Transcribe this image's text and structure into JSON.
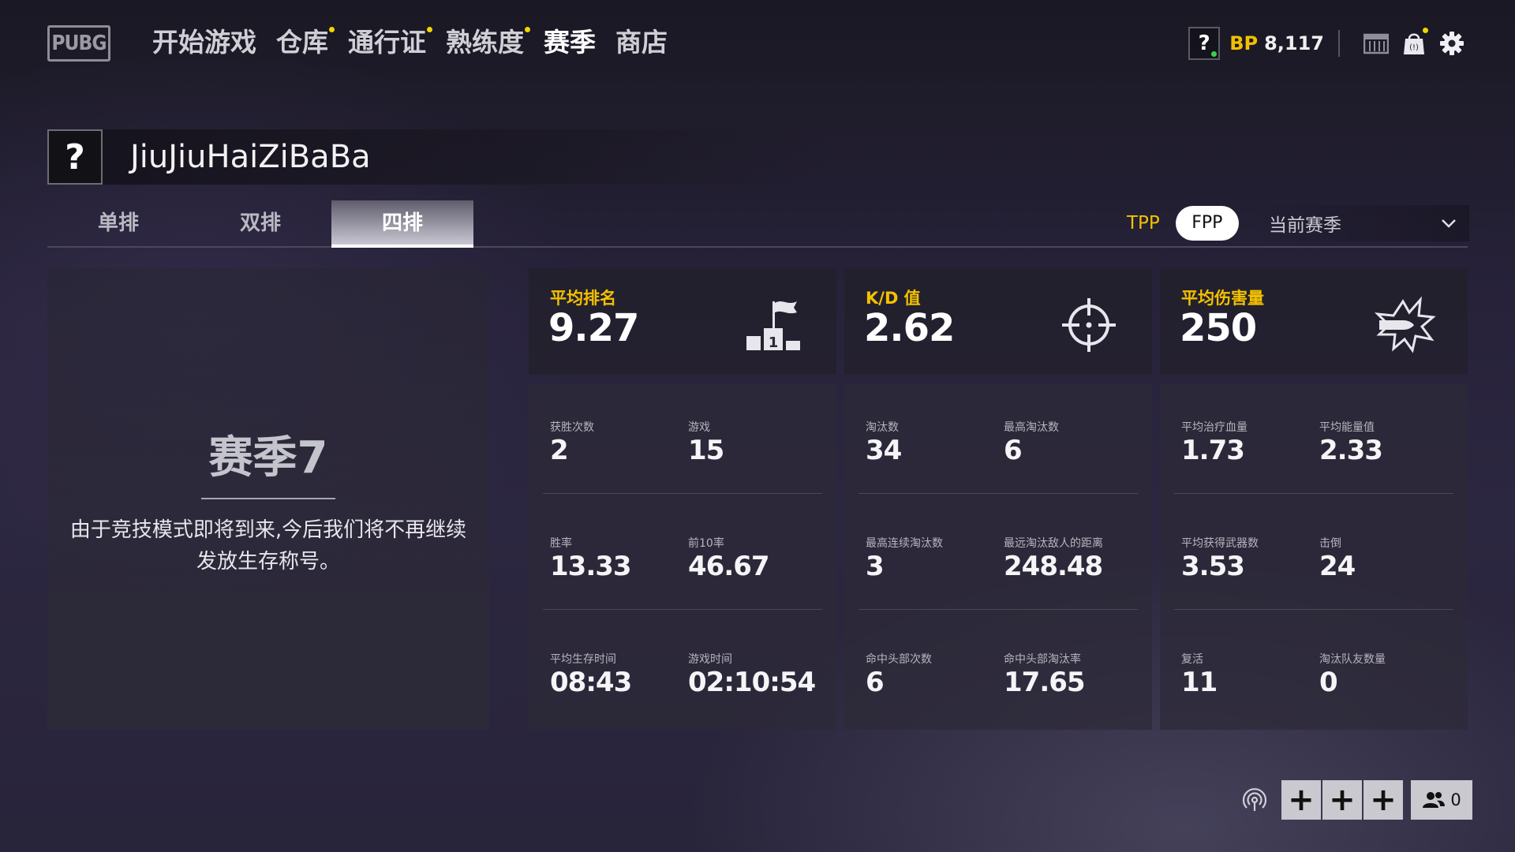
{
  "app": {
    "logo_text": "PUBG"
  },
  "nav": {
    "items": [
      {
        "label": "开始游戏",
        "badge": false,
        "active": false
      },
      {
        "label": "仓库",
        "badge": true,
        "active": false
      },
      {
        "label": "通行证",
        "badge": true,
        "active": false
      },
      {
        "label": "熟练度",
        "badge": true,
        "active": false
      },
      {
        "label": "赛季",
        "badge": false,
        "active": true
      },
      {
        "label": "商店",
        "badge": false,
        "active": false
      }
    ]
  },
  "topright": {
    "help_glyph": "?",
    "bp_label": "BP",
    "bp_value": "8,117",
    "icons": [
      "question-icon",
      "crate-icon",
      "shopping-bag-icon",
      "gear-icon"
    ]
  },
  "player": {
    "avatar_glyph": "?",
    "name": "JiuJiuHaiZiBaBa"
  },
  "modes": {
    "tabs": [
      {
        "label": "单排",
        "active": false
      },
      {
        "label": "双排",
        "active": false
      },
      {
        "label": "四排",
        "active": true
      }
    ],
    "perspective": {
      "tpp": "TPP",
      "fpp": "FPP",
      "selected": "FPP"
    },
    "season_select": {
      "value": "当前赛季"
    }
  },
  "season": {
    "title": "赛季7",
    "note": "由于竞技模式即将到来,今后我们将不再继续发放生存称号。"
  },
  "stats": {
    "col1": {
      "header": {
        "label": "平均排名",
        "value": "9.27",
        "icon": "podium-icon"
      },
      "rows": [
        [
          {
            "label": "获胜次数",
            "value": "2"
          },
          {
            "label": "游戏",
            "value": "15"
          }
        ],
        [
          {
            "label": "胜率",
            "value": "13.33"
          },
          {
            "label": "前10率",
            "value": "46.67"
          }
        ],
        [
          {
            "label": "平均生存时间",
            "value": "08:43"
          },
          {
            "label": "游戏时间",
            "value": "02:10:54"
          }
        ]
      ]
    },
    "col2": {
      "header": {
        "label": "K/D 值",
        "value": "2.62",
        "icon": "crosshair-icon"
      },
      "rows": [
        [
          {
            "label": "淘汰数",
            "value": "34"
          },
          {
            "label": "最高淘汰数",
            "value": "6"
          }
        ],
        [
          {
            "label": "最高连续淘汰数",
            "value": "3"
          },
          {
            "label": "最远淘汰敌人的距离",
            "value": "248.48"
          }
        ],
        [
          {
            "label": "命中头部次数",
            "value": "6"
          },
          {
            "label": "命中头部淘汰率",
            "value": "17.65"
          }
        ]
      ]
    },
    "col3": {
      "header": {
        "label": "平均伤害量",
        "value": "250",
        "icon": "bullet-impact-icon"
      },
      "rows": [
        [
          {
            "label": "平均治疗血量",
            "value": "1.73"
          },
          {
            "label": "平均能量值",
            "value": "2.33"
          }
        ],
        [
          {
            "label": "平均获得武器数",
            "value": "3.53"
          },
          {
            "label": "击倒",
            "value": "24"
          }
        ],
        [
          {
            "label": "复活",
            "value": "11"
          },
          {
            "label": "淘汰队友数量",
            "value": "0"
          }
        ]
      ]
    }
  },
  "bottom": {
    "plus_glyph": "+",
    "friends_count": "0",
    "icons": [
      "broadcast-icon",
      "friends-icon"
    ]
  },
  "colors": {
    "accent": "#f2c100",
    "badge": "#f2d400",
    "online": "#3bd14a"
  }
}
